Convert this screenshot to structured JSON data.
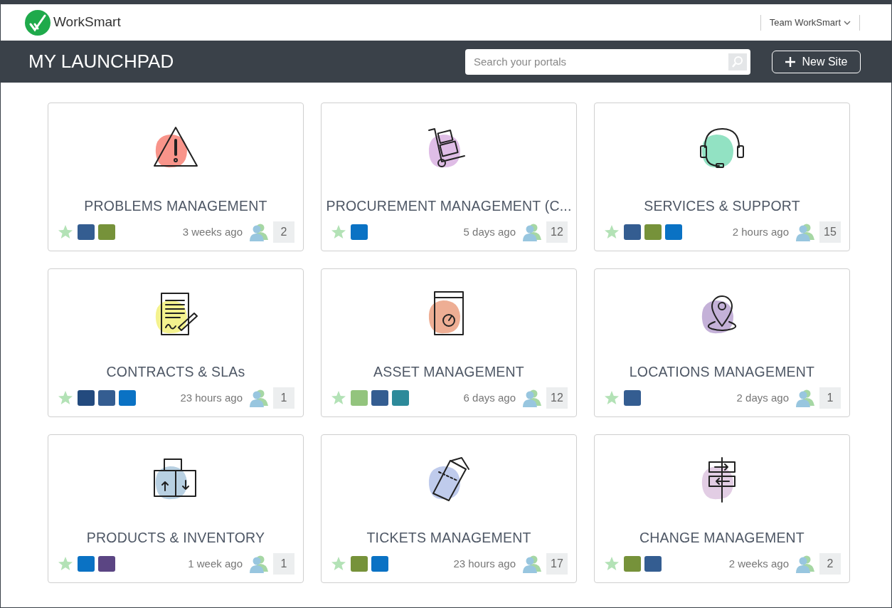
{
  "header": {
    "logo_text": "WorkSmart",
    "team_menu": "Team WorkSmart"
  },
  "toolbar": {
    "title": "MY LAUNCHPAD",
    "search": {
      "placeholder": "Search your portals"
    },
    "new_button": "New Site"
  },
  "portals": [
    {
      "title": "PROBLEMS MANAGEMENT",
      "kind": "warning",
      "color": "#f8948a",
      "tags": [
        {
          "color": "#345d91"
        },
        {
          "color": "#76923a"
        }
      ],
      "updated": "3 weeks ago",
      "members": "2"
    },
    {
      "title": "PROCUREMENT MANAGEMENT (C...",
      "kind": "trolley",
      "color": "#dfbde6",
      "tags": [
        {
          "color": "#0a72c4"
        }
      ],
      "updated": "5 days ago",
      "members": "12"
    },
    {
      "title": "SERVICES & SUPPORT",
      "kind": "headset",
      "color": "#92e2c3",
      "tags": [
        {
          "color": "#345d91"
        },
        {
          "color": "#76923a"
        },
        {
          "color": "#0a72c4"
        }
      ],
      "updated": "2 hours ago",
      "members": "15"
    },
    {
      "title": "CONTRACTS & SLAs",
      "kind": "contract",
      "color": "#f4f28e",
      "tags": [
        {
          "color": "#234a7e"
        },
        {
          "color": "#345d91"
        },
        {
          "color": "#0a72c4"
        }
      ],
      "updated": "23 hours ago",
      "members": "1"
    },
    {
      "title": "ASSET MANAGEMENT",
      "kind": "asset",
      "color": "#eeae94",
      "tags": [
        {
          "color": "#93c47d"
        },
        {
          "color": "#345d91"
        },
        {
          "color": "#2d8a9a"
        }
      ],
      "updated": "6 days ago",
      "members": "12"
    },
    {
      "title": "LOCATIONS MANAGEMENT",
      "kind": "location",
      "color": "#c4b1d8",
      "tags": [
        {
          "color": "#345d91"
        }
      ],
      "updated": "2 days ago",
      "members": "1"
    },
    {
      "title": "PRODUCTS & INVENTORY",
      "kind": "boxes",
      "color": "#b8d0e2",
      "tags": [
        {
          "color": "#0a72c4"
        },
        {
          "color": "#5b4583"
        }
      ],
      "updated": "1 week ago",
      "members": "1"
    },
    {
      "title": "TICKETS MANAGEMENT",
      "kind": "ticket",
      "color": "#bfcbec",
      "tags": [
        {
          "color": "#76923a"
        },
        {
          "color": "#0a72c4"
        }
      ],
      "updated": "23 hours ago",
      "members": "17"
    },
    {
      "title": "CHANGE MANAGEMENT",
      "kind": "signpost",
      "color": "#e2cde4",
      "tags": [
        {
          "color": "#76923a"
        },
        {
          "color": "#345d91"
        }
      ],
      "updated": "2 weeks ago",
      "members": "2"
    }
  ]
}
